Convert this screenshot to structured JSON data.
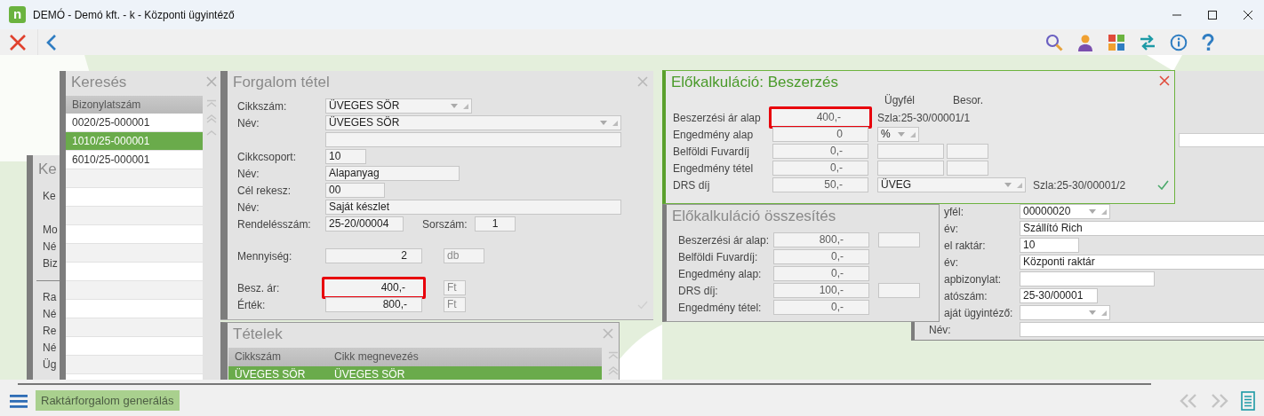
{
  "window": {
    "title": "DEMÓ - Demó kft. - k - Központi ügyintéző",
    "logo_text": "n"
  },
  "back_search_panel": {
    "title": "Ke",
    "labels": [
      "Ke",
      "Mo",
      "Né",
      "Biz",
      "Ra",
      "Né",
      "Re",
      "Né",
      "Üg"
    ]
  },
  "search_panel": {
    "title": "Keresés",
    "column": "Bizonylatszám",
    "rows": [
      {
        "text": "0020/25-000001",
        "selected": false
      },
      {
        "text": "1010/25-000001",
        "selected": true
      },
      {
        "text": "6010/25-000001",
        "selected": false
      }
    ]
  },
  "item_form": {
    "title": "Forgalom tétel",
    "rows": [
      {
        "label": "Cikkszám:",
        "value": "ÜVEGES SÖR",
        "kind": "combo"
      },
      {
        "label": "Név:",
        "value": "ÜVEGES SÖR",
        "kind": "combo"
      },
      {
        "kind": "text"
      },
      {
        "label": "Cikkcsoport:",
        "value": "10",
        "kind": "text"
      },
      {
        "label": "Név:",
        "value": "Alapanyag",
        "kind": "text"
      },
      {
        "label": "Cél rekesz:",
        "value": "00",
        "kind": "text"
      },
      {
        "label": "Név:",
        "value": "Saját készlet",
        "kind": "text"
      },
      {
        "label": "Rendelésszám:",
        "value": "25-20/00004",
        "kind": "text",
        "extra_label": "Sorszám:",
        "extra_value": "1"
      },
      {
        "label": "Mennyiség:",
        "value": "2",
        "kind": "amount",
        "unit": "db",
        "highlighted": false
      },
      {
        "label": "Besz. ár:",
        "value": "400,-",
        "kind": "amount",
        "unit": "Ft",
        "highlighted": true
      },
      {
        "label": "Érték:",
        "value": "800,-",
        "kind": "amount",
        "unit": "Ft",
        "highlighted": false
      }
    ]
  },
  "items_panel": {
    "title": "Tételek",
    "columns": [
      "Cikkszám",
      "Cikk megnevezés"
    ],
    "rows": [
      {
        "cells": [
          "ÜVEGES SÖR",
          "ÜVEGES SÖR"
        ],
        "selected": true
      }
    ]
  },
  "supplier_form": {
    "rows": [
      {
        "label": "yfél:",
        "value": "00000020",
        "kind": "combo"
      },
      {
        "label": "év:",
        "value": "Szállító Rich",
        "kind": "text"
      },
      {
        "label": "el raktár:",
        "value": "10",
        "kind": "text"
      },
      {
        "label": "év:",
        "value": "Központi raktár",
        "kind": "text"
      },
      {
        "label": "apbizonylat:",
        "kind": "text"
      },
      {
        "label": "atószám:",
        "value": "25-30/00001",
        "kind": "text"
      },
      {
        "label": "aját ügyintéző:",
        "kind": "combo"
      },
      {
        "label": "Név:",
        "kind": "text"
      }
    ]
  },
  "purchase_calc": {
    "title": "Előkalkuláció: Beszerzés",
    "headers": [
      "Ügyfél",
      "Besor."
    ],
    "rows": [
      {
        "label": "Beszerzési ár alap",
        "value": "400,-",
        "highlighted": true,
        "kind": "reference",
        "reference": "Szla:25-30/00001/1"
      },
      {
        "label": "Engedmény alap",
        "value": "0",
        "highlighted": false,
        "kind": "unit",
        "option": "%"
      },
      {
        "label": "Belföldi Fuvardíj",
        "value": "0,-",
        "highlighted": false,
        "kind": "pair"
      },
      {
        "label": "Engedmény tétel",
        "value": "0,-",
        "highlighted": false,
        "kind": "pair"
      },
      {
        "label": "DRS díj",
        "value": "50,-",
        "highlighted": false,
        "kind": "deposit",
        "option": "ÜVEG",
        "reference": "Szla:25-30/00001/2"
      }
    ]
  },
  "calc_summary": {
    "title": "Előkalkuláció összesítés",
    "rows": [
      {
        "label": "Beszerzési ár alap:",
        "value": "800,-",
        "extra_box": true
      },
      {
        "label": "Belföldi Fuvardíj:",
        "value": "0,-",
        "extra_box": false
      },
      {
        "label": "Engedmény alap:",
        "value": "0,-",
        "extra_box": false
      },
      {
        "label": "DRS díj:",
        "value": "100,-",
        "extra_box": true
      },
      {
        "label": "Engedmény tétel:",
        "value": "0,-",
        "extra_box": false
      }
    ]
  },
  "bottom_bar": {
    "button": "Raktárforgalom generálás"
  }
}
